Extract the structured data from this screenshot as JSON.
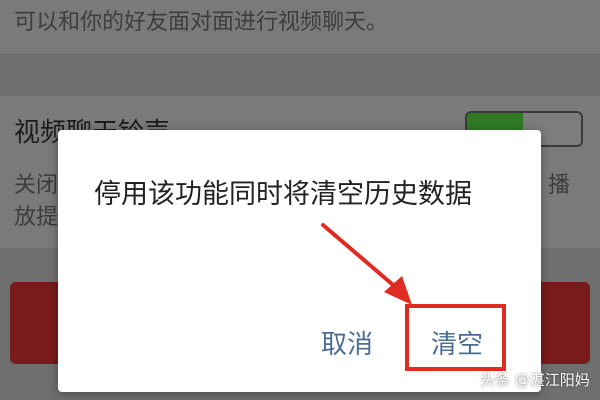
{
  "top_section": {
    "description": "可以和你的好友面对面进行视频聊天。"
  },
  "setting": {
    "title": "视频聊天铃声",
    "description_line1": "关闭",
    "description_line2": "放提",
    "description_right": "播",
    "toggle_on": true
  },
  "dialog": {
    "message": "停用该功能同时将清空历史数据",
    "cancel_label": "取消",
    "confirm_label": "清空"
  },
  "annotation": {
    "color": "#e02b22"
  },
  "watermark": "头条 @湛江阳妈",
  "colors": {
    "accent_text": "#4c6d93",
    "toggle_green": "#2f7a23",
    "danger": "#7a1b1b"
  }
}
